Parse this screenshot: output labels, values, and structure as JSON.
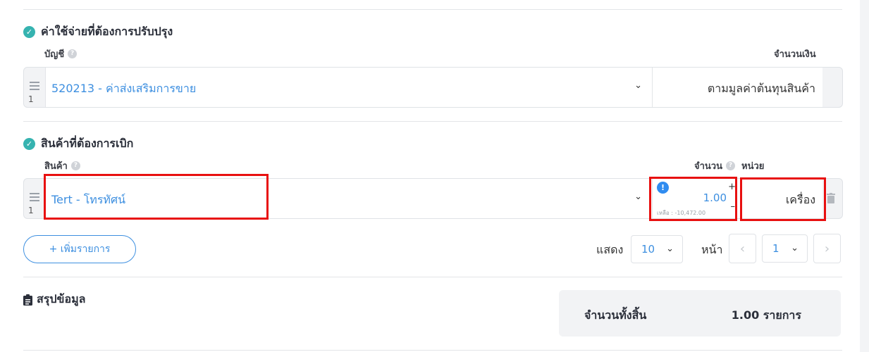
{
  "adjust_section": {
    "title": "ค่าใช้จ่ายที่ต้องการปรับปรุง",
    "account_label": "บัญชี",
    "amount_label": "จำนวนเงิน",
    "row": {
      "index": "1",
      "account_value": "520213 - ค่าส่งเสริมการขาย",
      "amount_value": "ตามมูลค่าต้นทุนสินค้า"
    }
  },
  "product_section": {
    "title": "สินค้าที่ต้องการเบิก",
    "product_label": "สินค้า",
    "qty_label": "จำนวน",
    "unit_label": "หน่วย",
    "row": {
      "index": "1",
      "product_value": "Tert - โทรทัศน์",
      "qty_value": "1.00",
      "remaining": "เหลือ : -10,472.00",
      "unit_value": "เครื่อง"
    }
  },
  "add_button_label": "+ เพิ่มรายการ",
  "pagination": {
    "show_label": "แสดง",
    "page_size": "10",
    "page_label": "หน้า",
    "page_value": "1"
  },
  "summary": {
    "title": "สรุปข้อมูล",
    "total_label": "จำนวนทั้งสิ้น",
    "total_value": "1.00 รายการ"
  },
  "colors": {
    "accent": "#3d8fe0",
    "check": "#36b3b0",
    "highlight": "#e81010"
  }
}
